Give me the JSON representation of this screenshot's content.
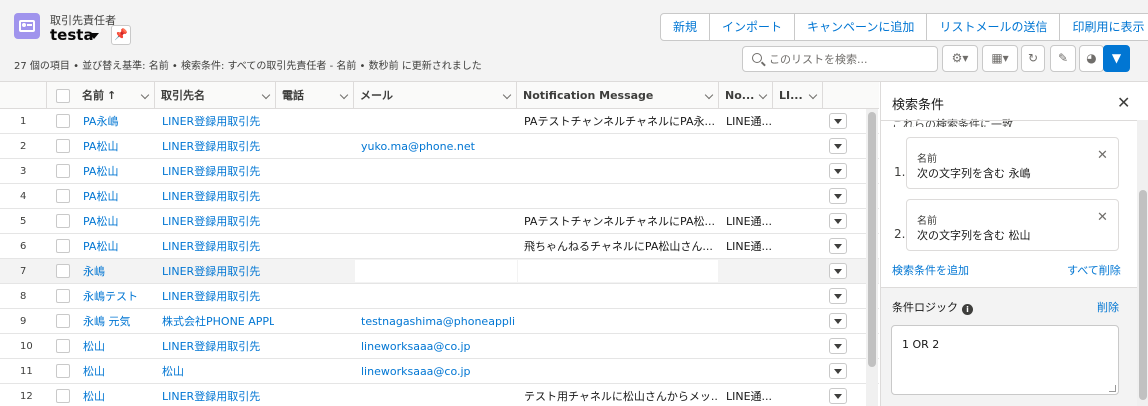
{
  "header": {
    "object_label": "取引先責任者",
    "view_name": "testa",
    "status": "27 個の項目 • 並び替え基準: 名前 • 検索条件: すべての取引先責任者 - 名前 • 数秒前 に更新されました",
    "actions": [
      "新規",
      "インポート",
      "キャンペーンに追加",
      "リストメールの送信",
      "印刷用に表示"
    ],
    "search_placeholder": "このリストを検索..."
  },
  "table": {
    "columns": [
      "名前",
      "取引先名",
      "電話",
      "メール",
      "Notification Message",
      "No...",
      "LI..."
    ],
    "sort_indicator": "↑",
    "rows": [
      {
        "n": "1",
        "name": "PA永嶋",
        "account": "LINER登録用取引先",
        "phone": "",
        "email": "",
        "message": "PAテストチャンネルチャネルにPA永...",
        "no": "LINE通...",
        "li": ""
      },
      {
        "n": "2",
        "name": "PA松山",
        "account": "LINER登録用取引先",
        "phone": "",
        "email": "yuko.ma@phone.net",
        "message": "",
        "no": "",
        "li": ""
      },
      {
        "n": "3",
        "name": "PA松山",
        "account": "LINER登録用取引先",
        "phone": "",
        "email": "",
        "message": "",
        "no": "",
        "li": ""
      },
      {
        "n": "4",
        "name": "PA松山",
        "account": "LINER登録用取引先",
        "phone": "",
        "email": "",
        "message": "",
        "no": "",
        "li": ""
      },
      {
        "n": "5",
        "name": "PA松山",
        "account": "LINER登録用取引先",
        "phone": "",
        "email": "",
        "message": "PAテストチャンネルチャネルにPA松...",
        "no": "LINE通...",
        "li": ""
      },
      {
        "n": "6",
        "name": "PA松山",
        "account": "LINER登録用取引先",
        "phone": "",
        "email": "",
        "message": "飛ちゃんねるチャネルにPA松山さん...",
        "no": "LINE通...",
        "li": ""
      },
      {
        "n": "7",
        "name": "永嶋",
        "account": "LINER登録用取引先",
        "phone": "",
        "email": "",
        "message": "",
        "no": "",
        "li": ""
      },
      {
        "n": "8",
        "name": "永嶋テスト",
        "account": "LINER登録用取引先",
        "phone": "",
        "email": "",
        "message": "",
        "no": "",
        "li": ""
      },
      {
        "n": "9",
        "name": "永嶋 元気",
        "account": "株式会社PHONE APPLI",
        "phone": "",
        "email": "testnagashima@phoneappli.net",
        "message": "",
        "no": "",
        "li": ""
      },
      {
        "n": "10",
        "name": "松山",
        "account": "LINER登録用取引先",
        "phone": "",
        "email": "lineworksaaa@co.jp",
        "message": "",
        "no": "",
        "li": ""
      },
      {
        "n": "11",
        "name": "松山",
        "account": "松山",
        "phone": "",
        "email": "lineworksaaa@co.jp",
        "message": "",
        "no": "",
        "li": ""
      },
      {
        "n": "12",
        "name": "松山",
        "account": "LINER登録用取引先",
        "phone": "",
        "email": "",
        "message": "テスト用チャネルに松山さんからメッ...",
        "no": "LINE通...",
        "li": ""
      }
    ]
  },
  "filter_panel": {
    "title": "検索条件",
    "match_text": "これらの検索条件に一致",
    "filters": [
      {
        "num": "1.",
        "field": "名前",
        "condition": "次の文字列を含む  永嶋"
      },
      {
        "num": "2.",
        "field": "名前",
        "condition": "次の文字列を含む  松山"
      }
    ],
    "add_filter": "検索条件を追加",
    "remove_all": "すべて削除",
    "logic_label": "条件ロジック",
    "logic_remove": "削除",
    "logic_value": "1 OR 2"
  },
  "colors": {
    "accent": "#0176d3",
    "object_icon": "#a094ed"
  }
}
